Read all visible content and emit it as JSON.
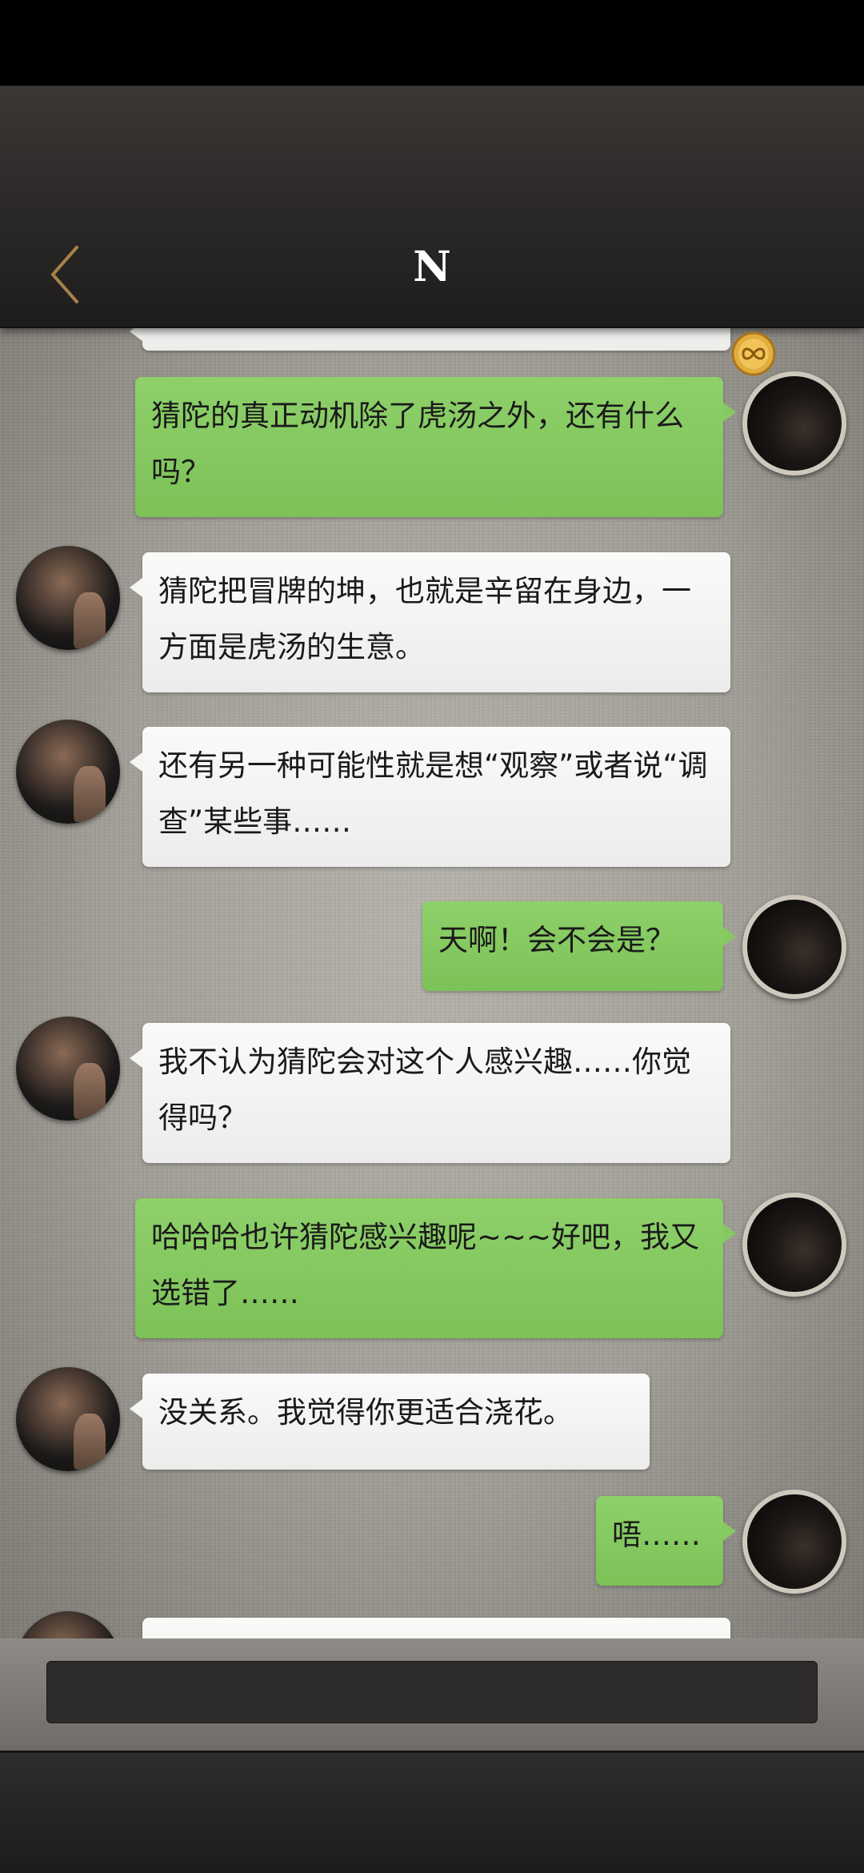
{
  "header": {
    "title": "N",
    "back_icon": "chevron-left-icon",
    "badge_icon": "infinity-badge-icon",
    "badge_color": "#d9a73a"
  },
  "messages": [
    {
      "side": "out",
      "text": "猜陀的真正动机除了虎汤之外，还有什么吗？"
    },
    {
      "side": "in",
      "text": "猜陀把冒牌的坤，也就是辛留在身边，一方面是虎汤的生意。"
    },
    {
      "side": "in",
      "text": "还有另一种可能性就是想“观察”或者说“调查”某些事……"
    },
    {
      "side": "out",
      "text": "天啊！会不会是？"
    },
    {
      "side": "in",
      "text": "我不认为猜陀会对这个人感兴趣……你觉得吗？"
    },
    {
      "side": "out",
      "text": "哈哈哈也许猜陀感兴趣呢~~~好吧，我又选错了……"
    },
    {
      "side": "in",
      "text": "没关系。我觉得你更适合浇花。"
    },
    {
      "side": "out",
      "text": "唔……"
    }
  ],
  "input": {
    "placeholder": ""
  },
  "colors": {
    "outgoing_bubble": "#86c962",
    "incoming_bubble": "#f5f5f3",
    "header_bg": "#2a2827"
  }
}
